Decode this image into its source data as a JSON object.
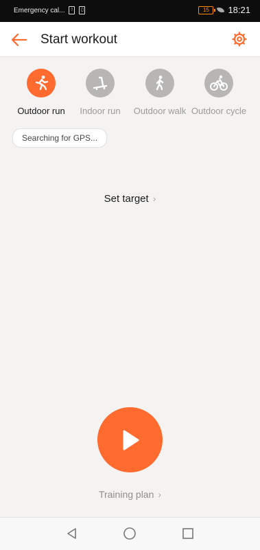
{
  "status_bar": {
    "carrier_text": "Emergency cal...",
    "sim_icon": "sim-card-icon",
    "battery_level": "15",
    "time": "18:21"
  },
  "header": {
    "title": "Start workout",
    "back_icon": "arrow-left-icon",
    "settings_icon": "gear-icon",
    "accent_color": "#ff6a2e"
  },
  "modes": [
    {
      "label": "Outdoor run",
      "icon": "running-person-icon",
      "active": true
    },
    {
      "label": "Indoor run",
      "icon": "treadmill-icon",
      "active": false
    },
    {
      "label": "Outdoor walk",
      "icon": "walking-person-icon",
      "active": false
    },
    {
      "label": "Outdoor cycle",
      "icon": "cyclist-icon",
      "active": false
    }
  ],
  "gps_status": "Searching for GPS...",
  "set_target_label": "Set target",
  "start_icon": "play-icon",
  "training_plan_label": "Training plan",
  "nav": {
    "back_icon": "triangle-back-icon",
    "home_icon": "circle-home-icon",
    "recents_icon": "square-recents-icon"
  }
}
